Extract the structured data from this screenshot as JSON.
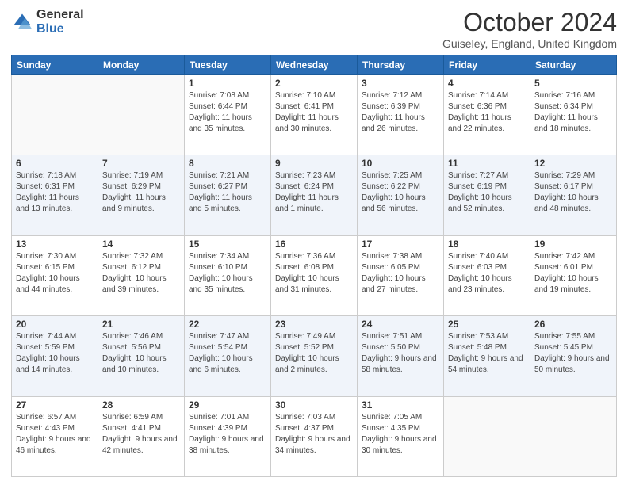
{
  "logo": {
    "general": "General",
    "blue": "Blue"
  },
  "header": {
    "month": "October 2024",
    "location": "Guiseley, England, United Kingdom"
  },
  "days_of_week": [
    "Sunday",
    "Monday",
    "Tuesday",
    "Wednesday",
    "Thursday",
    "Friday",
    "Saturday"
  ],
  "weeks": [
    [
      {
        "day": "",
        "info": ""
      },
      {
        "day": "",
        "info": ""
      },
      {
        "day": "1",
        "info": "Sunrise: 7:08 AM\nSunset: 6:44 PM\nDaylight: 11 hours and 35 minutes."
      },
      {
        "day": "2",
        "info": "Sunrise: 7:10 AM\nSunset: 6:41 PM\nDaylight: 11 hours and 30 minutes."
      },
      {
        "day": "3",
        "info": "Sunrise: 7:12 AM\nSunset: 6:39 PM\nDaylight: 11 hours and 26 minutes."
      },
      {
        "day": "4",
        "info": "Sunrise: 7:14 AM\nSunset: 6:36 PM\nDaylight: 11 hours and 22 minutes."
      },
      {
        "day": "5",
        "info": "Sunrise: 7:16 AM\nSunset: 6:34 PM\nDaylight: 11 hours and 18 minutes."
      }
    ],
    [
      {
        "day": "6",
        "info": "Sunrise: 7:18 AM\nSunset: 6:31 PM\nDaylight: 11 hours and 13 minutes."
      },
      {
        "day": "7",
        "info": "Sunrise: 7:19 AM\nSunset: 6:29 PM\nDaylight: 11 hours and 9 minutes."
      },
      {
        "day": "8",
        "info": "Sunrise: 7:21 AM\nSunset: 6:27 PM\nDaylight: 11 hours and 5 minutes."
      },
      {
        "day": "9",
        "info": "Sunrise: 7:23 AM\nSunset: 6:24 PM\nDaylight: 11 hours and 1 minute."
      },
      {
        "day": "10",
        "info": "Sunrise: 7:25 AM\nSunset: 6:22 PM\nDaylight: 10 hours and 56 minutes."
      },
      {
        "day": "11",
        "info": "Sunrise: 7:27 AM\nSunset: 6:19 PM\nDaylight: 10 hours and 52 minutes."
      },
      {
        "day": "12",
        "info": "Sunrise: 7:29 AM\nSunset: 6:17 PM\nDaylight: 10 hours and 48 minutes."
      }
    ],
    [
      {
        "day": "13",
        "info": "Sunrise: 7:30 AM\nSunset: 6:15 PM\nDaylight: 10 hours and 44 minutes."
      },
      {
        "day": "14",
        "info": "Sunrise: 7:32 AM\nSunset: 6:12 PM\nDaylight: 10 hours and 39 minutes."
      },
      {
        "day": "15",
        "info": "Sunrise: 7:34 AM\nSunset: 6:10 PM\nDaylight: 10 hours and 35 minutes."
      },
      {
        "day": "16",
        "info": "Sunrise: 7:36 AM\nSunset: 6:08 PM\nDaylight: 10 hours and 31 minutes."
      },
      {
        "day": "17",
        "info": "Sunrise: 7:38 AM\nSunset: 6:05 PM\nDaylight: 10 hours and 27 minutes."
      },
      {
        "day": "18",
        "info": "Sunrise: 7:40 AM\nSunset: 6:03 PM\nDaylight: 10 hours and 23 minutes."
      },
      {
        "day": "19",
        "info": "Sunrise: 7:42 AM\nSunset: 6:01 PM\nDaylight: 10 hours and 19 minutes."
      }
    ],
    [
      {
        "day": "20",
        "info": "Sunrise: 7:44 AM\nSunset: 5:59 PM\nDaylight: 10 hours and 14 minutes."
      },
      {
        "day": "21",
        "info": "Sunrise: 7:46 AM\nSunset: 5:56 PM\nDaylight: 10 hours and 10 minutes."
      },
      {
        "day": "22",
        "info": "Sunrise: 7:47 AM\nSunset: 5:54 PM\nDaylight: 10 hours and 6 minutes."
      },
      {
        "day": "23",
        "info": "Sunrise: 7:49 AM\nSunset: 5:52 PM\nDaylight: 10 hours and 2 minutes."
      },
      {
        "day": "24",
        "info": "Sunrise: 7:51 AM\nSunset: 5:50 PM\nDaylight: 9 hours and 58 minutes."
      },
      {
        "day": "25",
        "info": "Sunrise: 7:53 AM\nSunset: 5:48 PM\nDaylight: 9 hours and 54 minutes."
      },
      {
        "day": "26",
        "info": "Sunrise: 7:55 AM\nSunset: 5:45 PM\nDaylight: 9 hours and 50 minutes."
      }
    ],
    [
      {
        "day": "27",
        "info": "Sunrise: 6:57 AM\nSunset: 4:43 PM\nDaylight: 9 hours and 46 minutes."
      },
      {
        "day": "28",
        "info": "Sunrise: 6:59 AM\nSunset: 4:41 PM\nDaylight: 9 hours and 42 minutes."
      },
      {
        "day": "29",
        "info": "Sunrise: 7:01 AM\nSunset: 4:39 PM\nDaylight: 9 hours and 38 minutes."
      },
      {
        "day": "30",
        "info": "Sunrise: 7:03 AM\nSunset: 4:37 PM\nDaylight: 9 hours and 34 minutes."
      },
      {
        "day": "31",
        "info": "Sunrise: 7:05 AM\nSunset: 4:35 PM\nDaylight: 9 hours and 30 minutes."
      },
      {
        "day": "",
        "info": ""
      },
      {
        "day": "",
        "info": ""
      }
    ]
  ]
}
